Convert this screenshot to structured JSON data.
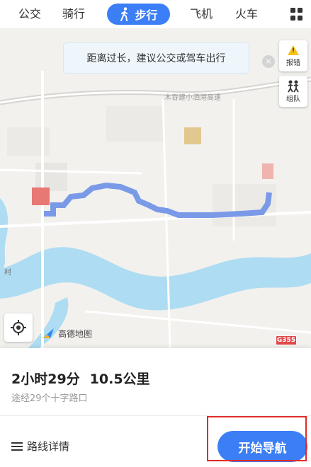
{
  "tabs": {
    "bus": "公交",
    "bike": "骑行",
    "walk": "步行",
    "plane": "飞机",
    "train": "火车"
  },
  "map": {
    "tip_text": "距离过长，建议公交或驾车出行",
    "tip_close": "×",
    "road_label": "木吞建小洒港高速",
    "report_label": "报错",
    "team_label": "组队",
    "logo_text": "高德地图",
    "road_badge": "G355",
    "village_label": "村"
  },
  "route": {
    "duration": "2小时29分",
    "distance": "10.5公里",
    "via": "途经29个十字路口",
    "detail_label": "路线详情",
    "start_label": "开始导航"
  },
  "colors": {
    "accent": "#3b7ef6",
    "highlight": "#e22a2a",
    "river": "#aedcf2"
  }
}
